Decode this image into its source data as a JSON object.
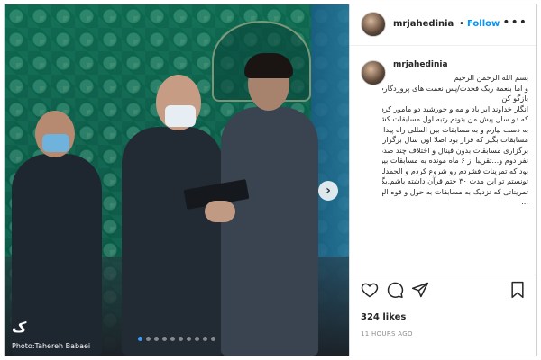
{
  "post": {
    "username": "mrjahedinia",
    "separator": "•",
    "follow_label": "Follow",
    "more_label": "•••",
    "caption_lines": [
      "بسم الله الرحمن الرحیم",
      "و اما بنعمة ربک فحدث/پس نعمت های پروردگارت را",
      "بازگو کن",
      "انگار خداوند ابر باد و مه و خورشید دو مامور کرده بود",
      "که دو سال پیش من بتونم رتبه اول مسابقات کشوری رو",
      "به دست بیارم و به مسابقات بین المللی راه پیدا کنم از تک",
      "مسابقات بگیر که قرار بود اصلا اون سال برگزار نشه تا",
      "برگزاری مسابقات بدون فینال و اختلاف چند صدم با",
      "نفر دوم و...تقریبا از ۶ ماه مونده به مسابقات بین المللی",
      "بود که تمرینات فشردم رو شروع کردم و الحمدلله",
      "تونستم تو این مدت ۳۰ ختم قرآن داشته باشم.بگذریم از",
      "تمریناتی که نزدیک به مسابقات به حول و قوه الهی به",
      "..."
    ],
    "likes": "324 likes",
    "time_ago": "11 HOURS AGO"
  },
  "photo": {
    "credit": "Photo:Tahereh Babaei",
    "agency_logo": "ک",
    "slides_count": 10,
    "active_slide": 0,
    "next_arrow": "›"
  },
  "icons": [
    "heart-icon",
    "comment-icon",
    "share-icon",
    "bookmark-icon"
  ],
  "colors": {
    "follow": "#0095f6",
    "text": "#262626",
    "muted": "#8e8e8e"
  }
}
